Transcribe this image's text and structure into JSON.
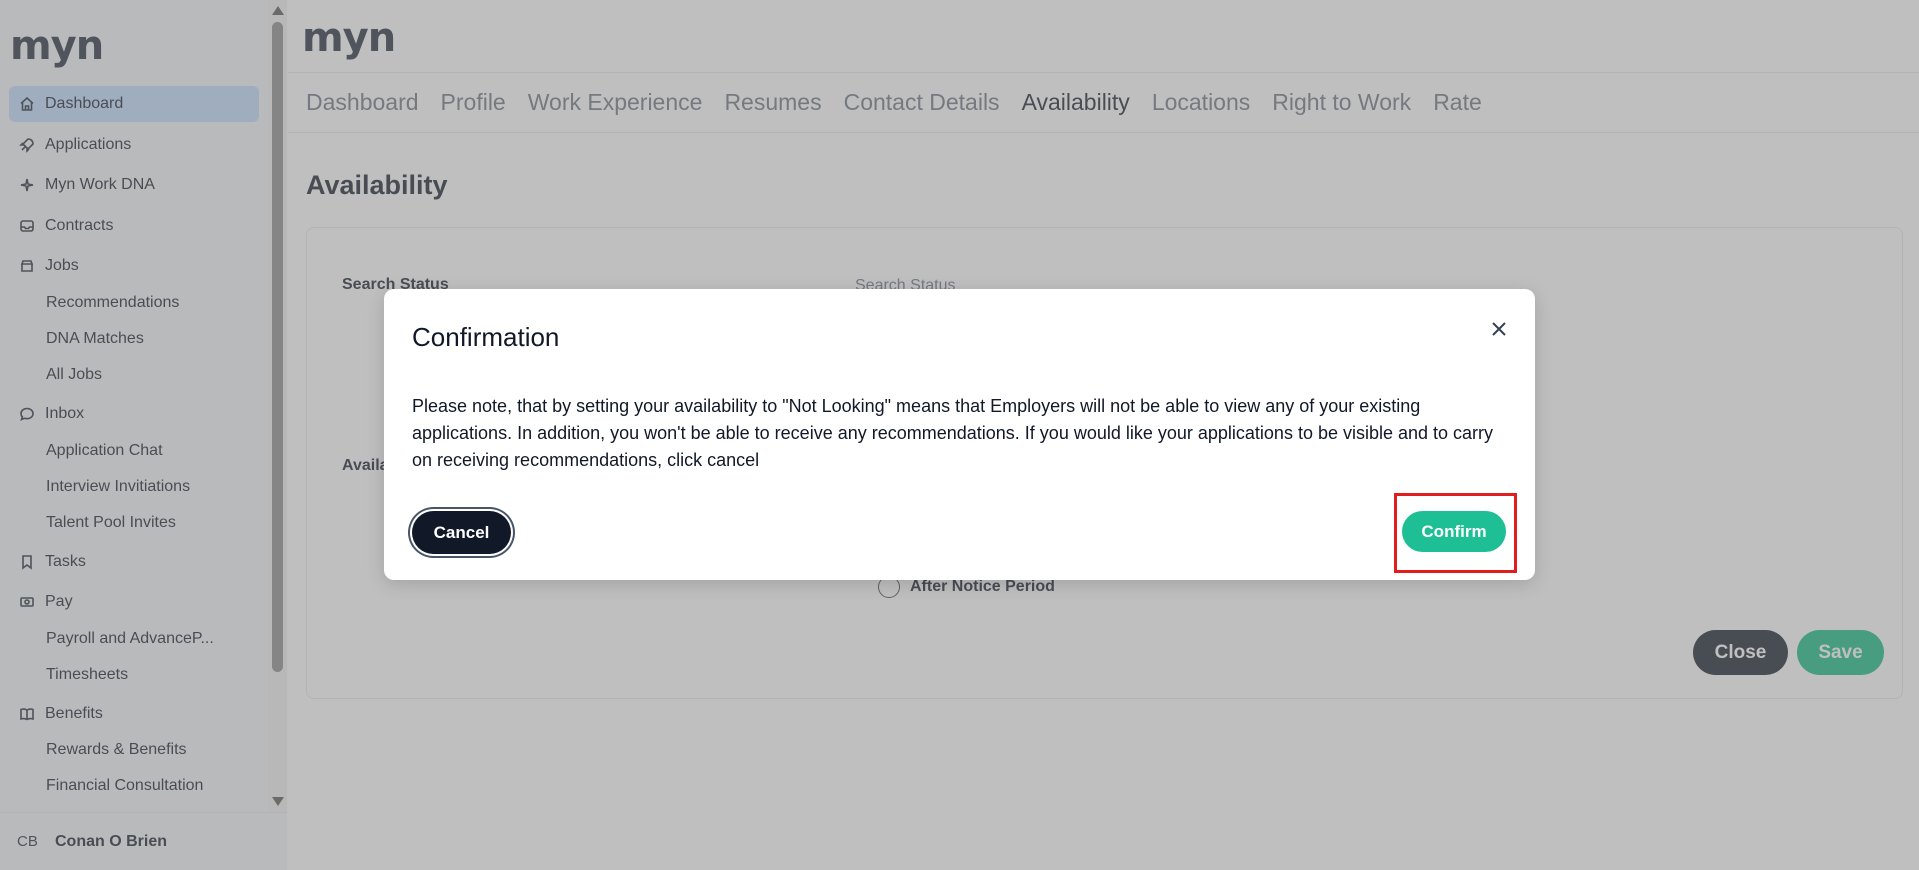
{
  "sidebar": {
    "logo": "myn",
    "items": [
      {
        "label": "Dashboard",
        "icon": "home-icon",
        "active": true
      },
      {
        "label": "Applications",
        "icon": "rocket-icon"
      },
      {
        "label": "Myn Work DNA",
        "icon": "sparkle-icon"
      },
      {
        "label": "Contracts",
        "icon": "inbox-tray-icon"
      },
      {
        "label": "Jobs",
        "icon": "archive-icon"
      }
    ],
    "jobs_sub": [
      "Recommendations",
      "DNA Matches",
      "All Jobs"
    ],
    "inbox": {
      "label": "Inbox",
      "icon": "chat-bubble-icon"
    },
    "inbox_sub": [
      "Application Chat",
      "Interview Invitiations",
      "Talent Pool Invites"
    ],
    "tasks": {
      "label": "Tasks",
      "icon": "bookmark-icon"
    },
    "pay": {
      "label": "Pay",
      "icon": "cash-icon"
    },
    "pay_sub": [
      "Payroll and AdvanceP...",
      "Timesheets"
    ],
    "benefits": {
      "label": "Benefits",
      "icon": "book-icon"
    },
    "benefits_sub": [
      "Rewards & Benefits",
      "Financial Consultation"
    ],
    "user": {
      "initials": "CB",
      "name": "Conan O Brien"
    }
  },
  "header": {
    "logo": "myn"
  },
  "tabs": [
    {
      "label": "Dashboard"
    },
    {
      "label": "Profile"
    },
    {
      "label": "Work Experience"
    },
    {
      "label": "Resumes"
    },
    {
      "label": "Contact Details"
    },
    {
      "label": "Availability",
      "active": true
    },
    {
      "label": "Locations"
    },
    {
      "label": "Right to Work"
    },
    {
      "label": "Rate"
    }
  ],
  "page": {
    "title": "Availability",
    "search_status_label": "Search Status",
    "search_status_placeholder": "Search Status",
    "availability_label": "Availa",
    "radio_after_notice": "After Notice Period",
    "close_label": "Close",
    "save_label": "Save"
  },
  "modal": {
    "title": "Confirmation",
    "body": "Please note, that by setting your availability to \"Not Looking\" means that Employers will not be able to view any of your existing applications. In addition, you won't be able to receive any recommendations. If you would like your applications to be visible and to carry on receiving recommendations, click cancel",
    "cancel_label": "Cancel",
    "confirm_label": "Confirm"
  },
  "colors": {
    "accent": "#10b981",
    "dark": "#111827",
    "highlight": "#e11d1d",
    "active_nav": "#bfdbfe"
  }
}
